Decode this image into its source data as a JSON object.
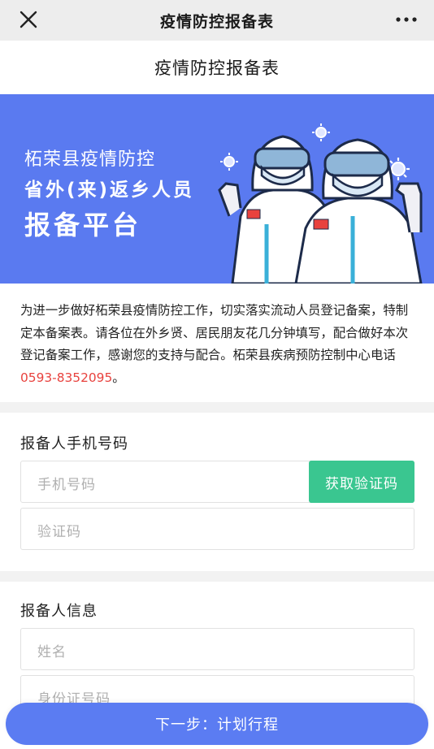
{
  "topbar": {
    "title": "疫情防控报备表",
    "close_icon": "close-icon",
    "more_icon": "more-icon"
  },
  "page": {
    "heading": "疫情防控报备表"
  },
  "banner": {
    "line1": "柘荣县疫情防控",
    "line2": "省外(来)返乡人员",
    "line3": "报备平台",
    "flag_text": "",
    "color": "#5a7af0"
  },
  "intro": {
    "text": "为进一步做好柘荣县疫情防控工作，切实落实流动人员登记备案，特制定本备案表。请各位在外乡贤、居民朋友花几分钟填写，配合做好本次登记备案工作，感谢您的支持与配合。柘荣县疾病预防控制中心电话",
    "phone": "0593-8352095",
    "tail": "。"
  },
  "phone_section": {
    "title": "报备人手机号码",
    "phone_placeholder": "手机号码",
    "code_button": "获取验证码",
    "code_placeholder": "验证码"
  },
  "info_section": {
    "title": "报备人信息",
    "name_placeholder": "姓名",
    "id_placeholder": "身份证号码"
  },
  "footer": {
    "next_button": "下一步：计划行程"
  },
  "colors": {
    "accent": "#5b7cf2",
    "green": "#3ac690",
    "phone_red": "#e8423e"
  }
}
